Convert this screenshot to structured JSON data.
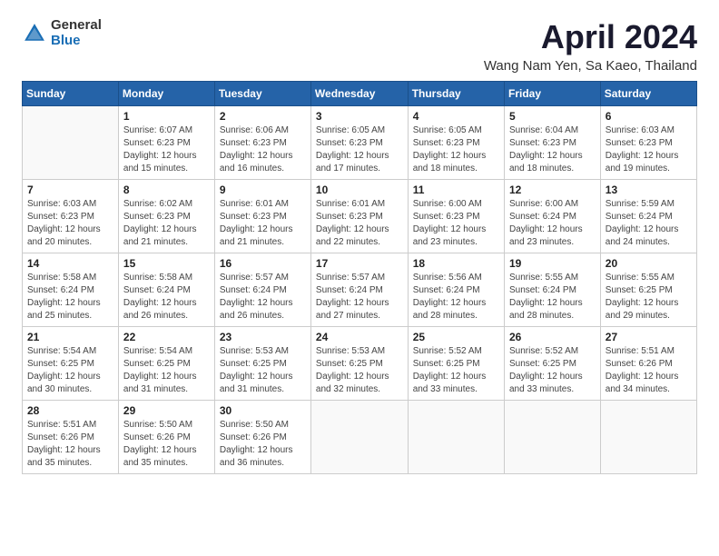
{
  "logo": {
    "general": "General",
    "blue": "Blue"
  },
  "title": "April 2024",
  "subtitle": "Wang Nam Yen, Sa Kaeo, Thailand",
  "days_header": [
    "Sunday",
    "Monday",
    "Tuesday",
    "Wednesday",
    "Thursday",
    "Friday",
    "Saturday"
  ],
  "weeks": [
    [
      {
        "day": "",
        "sunrise": "",
        "sunset": "",
        "daylight": ""
      },
      {
        "day": "1",
        "sunrise": "Sunrise: 6:07 AM",
        "sunset": "Sunset: 6:23 PM",
        "daylight": "Daylight: 12 hours and 15 minutes."
      },
      {
        "day": "2",
        "sunrise": "Sunrise: 6:06 AM",
        "sunset": "Sunset: 6:23 PM",
        "daylight": "Daylight: 12 hours and 16 minutes."
      },
      {
        "day": "3",
        "sunrise": "Sunrise: 6:05 AM",
        "sunset": "Sunset: 6:23 PM",
        "daylight": "Daylight: 12 hours and 17 minutes."
      },
      {
        "day": "4",
        "sunrise": "Sunrise: 6:05 AM",
        "sunset": "Sunset: 6:23 PM",
        "daylight": "Daylight: 12 hours and 18 minutes."
      },
      {
        "day": "5",
        "sunrise": "Sunrise: 6:04 AM",
        "sunset": "Sunset: 6:23 PM",
        "daylight": "Daylight: 12 hours and 18 minutes."
      },
      {
        "day": "6",
        "sunrise": "Sunrise: 6:03 AM",
        "sunset": "Sunset: 6:23 PM",
        "daylight": "Daylight: 12 hours and 19 minutes."
      }
    ],
    [
      {
        "day": "7",
        "sunrise": "Sunrise: 6:03 AM",
        "sunset": "Sunset: 6:23 PM",
        "daylight": "Daylight: 12 hours and 20 minutes."
      },
      {
        "day": "8",
        "sunrise": "Sunrise: 6:02 AM",
        "sunset": "Sunset: 6:23 PM",
        "daylight": "Daylight: 12 hours and 21 minutes."
      },
      {
        "day": "9",
        "sunrise": "Sunrise: 6:01 AM",
        "sunset": "Sunset: 6:23 PM",
        "daylight": "Daylight: 12 hours and 21 minutes."
      },
      {
        "day": "10",
        "sunrise": "Sunrise: 6:01 AM",
        "sunset": "Sunset: 6:23 PM",
        "daylight": "Daylight: 12 hours and 22 minutes."
      },
      {
        "day": "11",
        "sunrise": "Sunrise: 6:00 AM",
        "sunset": "Sunset: 6:23 PM",
        "daylight": "Daylight: 12 hours and 23 minutes."
      },
      {
        "day": "12",
        "sunrise": "Sunrise: 6:00 AM",
        "sunset": "Sunset: 6:24 PM",
        "daylight": "Daylight: 12 hours and 23 minutes."
      },
      {
        "day": "13",
        "sunrise": "Sunrise: 5:59 AM",
        "sunset": "Sunset: 6:24 PM",
        "daylight": "Daylight: 12 hours and 24 minutes."
      }
    ],
    [
      {
        "day": "14",
        "sunrise": "Sunrise: 5:58 AM",
        "sunset": "Sunset: 6:24 PM",
        "daylight": "Daylight: 12 hours and 25 minutes."
      },
      {
        "day": "15",
        "sunrise": "Sunrise: 5:58 AM",
        "sunset": "Sunset: 6:24 PM",
        "daylight": "Daylight: 12 hours and 26 minutes."
      },
      {
        "day": "16",
        "sunrise": "Sunrise: 5:57 AM",
        "sunset": "Sunset: 6:24 PM",
        "daylight": "Daylight: 12 hours and 26 minutes."
      },
      {
        "day": "17",
        "sunrise": "Sunrise: 5:57 AM",
        "sunset": "Sunset: 6:24 PM",
        "daylight": "Daylight: 12 hours and 27 minutes."
      },
      {
        "day": "18",
        "sunrise": "Sunrise: 5:56 AM",
        "sunset": "Sunset: 6:24 PM",
        "daylight": "Daylight: 12 hours and 28 minutes."
      },
      {
        "day": "19",
        "sunrise": "Sunrise: 5:55 AM",
        "sunset": "Sunset: 6:24 PM",
        "daylight": "Daylight: 12 hours and 28 minutes."
      },
      {
        "day": "20",
        "sunrise": "Sunrise: 5:55 AM",
        "sunset": "Sunset: 6:25 PM",
        "daylight": "Daylight: 12 hours and 29 minutes."
      }
    ],
    [
      {
        "day": "21",
        "sunrise": "Sunrise: 5:54 AM",
        "sunset": "Sunset: 6:25 PM",
        "daylight": "Daylight: 12 hours and 30 minutes."
      },
      {
        "day": "22",
        "sunrise": "Sunrise: 5:54 AM",
        "sunset": "Sunset: 6:25 PM",
        "daylight": "Daylight: 12 hours and 31 minutes."
      },
      {
        "day": "23",
        "sunrise": "Sunrise: 5:53 AM",
        "sunset": "Sunset: 6:25 PM",
        "daylight": "Daylight: 12 hours and 31 minutes."
      },
      {
        "day": "24",
        "sunrise": "Sunrise: 5:53 AM",
        "sunset": "Sunset: 6:25 PM",
        "daylight": "Daylight: 12 hours and 32 minutes."
      },
      {
        "day": "25",
        "sunrise": "Sunrise: 5:52 AM",
        "sunset": "Sunset: 6:25 PM",
        "daylight": "Daylight: 12 hours and 33 minutes."
      },
      {
        "day": "26",
        "sunrise": "Sunrise: 5:52 AM",
        "sunset": "Sunset: 6:25 PM",
        "daylight": "Daylight: 12 hours and 33 minutes."
      },
      {
        "day": "27",
        "sunrise": "Sunrise: 5:51 AM",
        "sunset": "Sunset: 6:26 PM",
        "daylight": "Daylight: 12 hours and 34 minutes."
      }
    ],
    [
      {
        "day": "28",
        "sunrise": "Sunrise: 5:51 AM",
        "sunset": "Sunset: 6:26 PM",
        "daylight": "Daylight: 12 hours and 35 minutes."
      },
      {
        "day": "29",
        "sunrise": "Sunrise: 5:50 AM",
        "sunset": "Sunset: 6:26 PM",
        "daylight": "Daylight: 12 hours and 35 minutes."
      },
      {
        "day": "30",
        "sunrise": "Sunrise: 5:50 AM",
        "sunset": "Sunset: 6:26 PM",
        "daylight": "Daylight: 12 hours and 36 minutes."
      },
      {
        "day": "",
        "sunrise": "",
        "sunset": "",
        "daylight": ""
      },
      {
        "day": "",
        "sunrise": "",
        "sunset": "",
        "daylight": ""
      },
      {
        "day": "",
        "sunrise": "",
        "sunset": "",
        "daylight": ""
      },
      {
        "day": "",
        "sunrise": "",
        "sunset": "",
        "daylight": ""
      }
    ]
  ]
}
